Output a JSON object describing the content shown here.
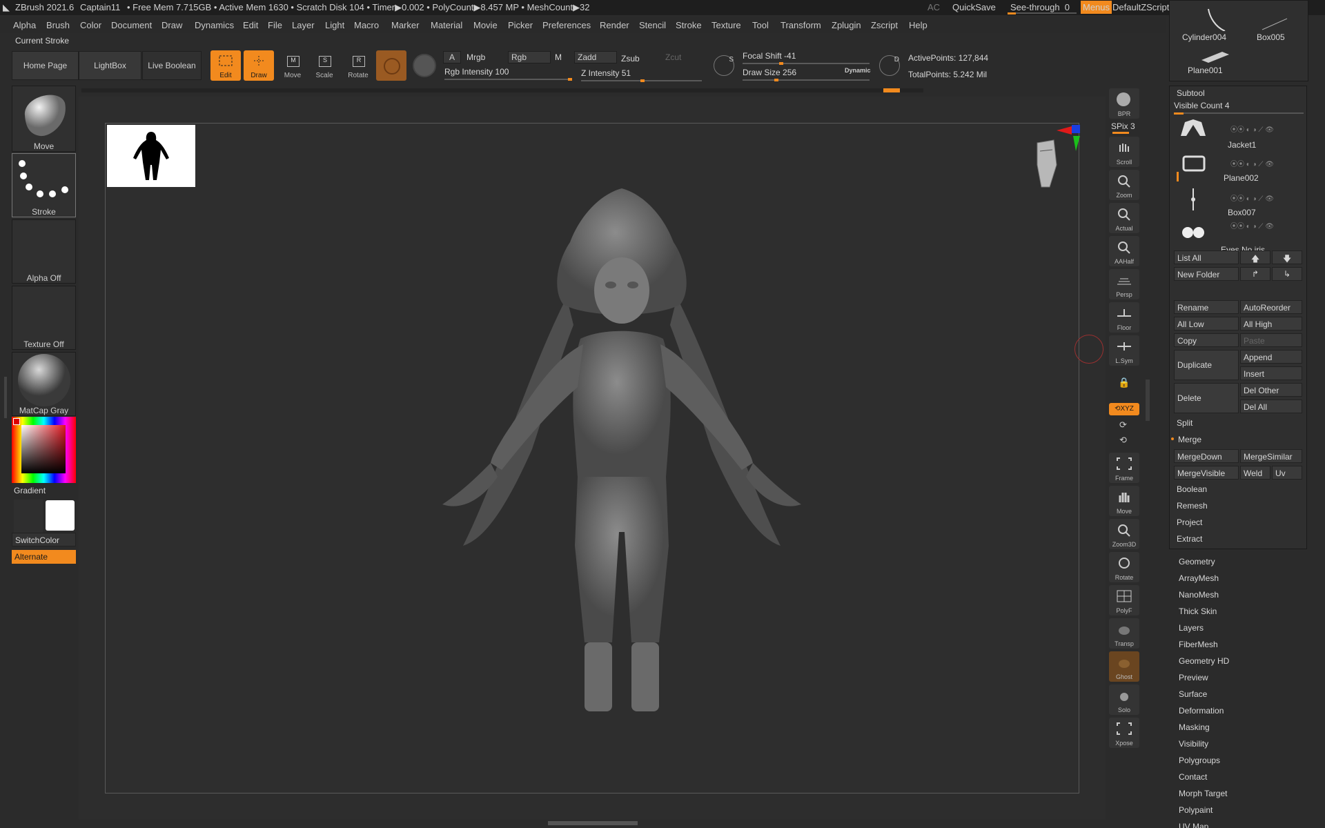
{
  "titlebar": {
    "app": "ZBrush 2021.6",
    "project": "Captain11",
    "stats": "• Free Mem 7.715GB • Active Mem 1630 • Scratch Disk 104 • Timer▶0.002 • PolyCount▶8.457 MP • MeshCount▶32",
    "ac": "AC",
    "quicksave": "QuickSave",
    "seethrough": "See-through",
    "seethrough_value": "0",
    "menus": "Menus",
    "zscript": "DefaultZScript"
  },
  "menus": [
    "Alpha",
    "Brush",
    "Color",
    "Document",
    "Draw",
    "Dynamics",
    "Edit",
    "File",
    "Layer",
    "Light",
    "Macro",
    "Marker",
    "Material",
    "Movie",
    "Picker",
    "Preferences",
    "Render",
    "Stencil",
    "Stroke",
    "Texture",
    "Tool",
    "Transform",
    "Zplugin",
    "Zscript",
    "Help"
  ],
  "current_stroke": "Current Stroke",
  "top_buttons": {
    "home": "Home Page",
    "lightbox": "LightBox",
    "liveboolean": "Live Boolean"
  },
  "modes": {
    "edit": "Edit",
    "draw": "Draw",
    "move": "Move",
    "scale": "Scale",
    "rotate": "Rotate"
  },
  "draw_settings": {
    "a": "A",
    "mrgb": "Mrgb",
    "rgb": "Rgb",
    "m": "M",
    "zadd": "Zadd",
    "zsub": "Zsub",
    "zcut": "Zcut",
    "rgb_intensity_label": "Rgb Intensity",
    "rgb_intensity": "100",
    "z_intensity_label": "Z Intensity",
    "z_intensity": "51",
    "focal_label": "Focal Shift",
    "focal": "-41",
    "draw_size_label": "Draw Size",
    "draw_size": "256",
    "dynamic": "Dynamic",
    "active_points": "ActivePoints: 127,844",
    "total_points": "TotalPoints: 5.242 Mil",
    "rgb_intensity_fraction": 1.0,
    "z_intensity_fraction": 0.51,
    "focal_fraction": 0.3,
    "draw_size_fraction": 0.26
  },
  "left_shelf": {
    "move": "Move",
    "stroke": "Stroke",
    "alpha": "Alpha Off",
    "texture": "Texture Off",
    "material": "MatCap Gray",
    "gradient": "Gradient",
    "switchcolor": "SwitchColor",
    "alternate": "Alternate"
  },
  "right_toolbar": [
    "BPR",
    "Scroll",
    "Zoom",
    "Actual",
    "AAHalf",
    "Persp",
    "Floor",
    "L.Sym",
    "Frame",
    "Move",
    "Zoom3D",
    "Rotate",
    "PolyF",
    "Transp",
    "Ghost",
    "Solo",
    "Xpose"
  ],
  "spix": "SPix 3",
  "tool_thumbs": [
    "Cylinder004",
    "Box005",
    "Plane001"
  ],
  "subtool": {
    "header": "Subtool",
    "visible_count": "Visible Count 4",
    "items": [
      "Jacket1",
      "Plane002",
      "Box007",
      "Eyes No iris"
    ],
    "buttons": {
      "list_all": "List All",
      "new_folder": "New Folder",
      "rename": "Rename",
      "autoreorder": "AutoReorder",
      "all_low": "All Low",
      "all_high": "All High",
      "copy": "Copy",
      "paste": "Paste",
      "duplicate": "Duplicate",
      "append": "Append",
      "insert": "Insert",
      "delete": "Delete",
      "del_other": "Del Other",
      "del_all": "Del All",
      "split": "Split",
      "merge": "Merge",
      "mergedown": "MergeDown",
      "mergesimilar": "MergeSimilar",
      "mergevisible": "MergeVisible",
      "weld": "Weld",
      "uv": "Uv",
      "boolean": "Boolean",
      "remesh": "Remesh",
      "project": "Project",
      "extract": "Extract"
    }
  },
  "tool_sections": [
    "Geometry",
    "ArrayMesh",
    "NanoMesh",
    "Thick Skin",
    "Layers",
    "FiberMesh",
    "Geometry HD",
    "Preview",
    "Surface",
    "Deformation",
    "Masking",
    "Visibility",
    "Polygroups",
    "Contact",
    "Morph Target",
    "Polypaint",
    "UV Map"
  ],
  "colors": {
    "accent": "#f28a1e",
    "bg": "#2b2b2b",
    "canvas": "#2e2e2e"
  }
}
